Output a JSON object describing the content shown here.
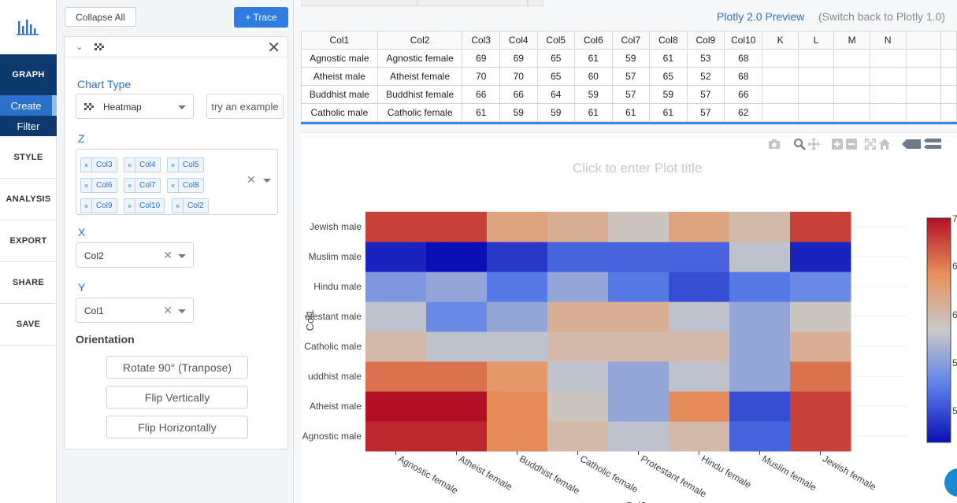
{
  "nav": {
    "graph": "GRAPH",
    "create": "Create",
    "filter": "Filter",
    "style": "STYLE",
    "analysis": "ANALYSIS",
    "export": "EXPORT",
    "share": "SHARE",
    "save": "SAVE"
  },
  "panel": {
    "collapse_all": "Collapse All",
    "add_trace": "+ Trace",
    "chart_type_title": "Chart Type",
    "chart_type_value": "Heatmap",
    "try_example": "try an example",
    "z_label": "Z",
    "z_chips": [
      "Col3",
      "Col4",
      "Col5",
      "Col6",
      "Col7",
      "Col8",
      "Col9",
      "Col10",
      "Col2"
    ],
    "x_label": "X",
    "x_value": "Col2",
    "y_label": "Y",
    "y_value": "Col1",
    "orientation_title": "Orientation",
    "rotate": "Rotate 90° (Tranpose)",
    "flip_v": "Flip Vertically",
    "flip_h": "Flip Horizontally",
    "clear_glyph": "✕",
    "chip_x": "×"
  },
  "header": {
    "preview": "Plotly 2.0 Preview",
    "switch_back": "(Switch back to Plotly 1.0)"
  },
  "grid": {
    "headers": [
      "Col1",
      "Col2",
      "Col3",
      "Col4",
      "Col5",
      "Col6",
      "Col7",
      "Col8",
      "Col9",
      "Col10",
      "K",
      "L",
      "M",
      "N",
      "",
      ""
    ],
    "rows": [
      [
        "Agnostic male",
        "Agnostic female",
        "69",
        "69",
        "65",
        "61",
        "59",
        "61",
        "53",
        "68",
        "",
        "",
        "",
        "",
        "",
        ""
      ],
      [
        "Atheist male",
        "Atheist female",
        "70",
        "70",
        "65",
        "60",
        "57",
        "65",
        "52",
        "68",
        "",
        "",
        "",
        "",
        "",
        ""
      ],
      [
        "Buddhist male",
        "Buddhist female",
        "66",
        "66",
        "64",
        "59",
        "57",
        "59",
        "57",
        "66",
        "",
        "",
        "",
        "",
        "",
        ""
      ],
      [
        "Catholic male",
        "Catholic female",
        "61",
        "59",
        "59",
        "61",
        "61",
        "61",
        "57",
        "62",
        "",
        "",
        "",
        "",
        "",
        ""
      ]
    ]
  },
  "plot": {
    "title_placeholder": "Click to enter Plot title"
  },
  "chart_data": {
    "type": "heatmap",
    "title": "",
    "ylabel": "Col1",
    "xlabel": "Col2",
    "x": [
      "Agnostic female",
      "Atheist female",
      "Buddhist female",
      "Catholic female",
      "Protestant female",
      "Hindu female",
      "Muslim female",
      "Jewish female"
    ],
    "y": [
      "Agnostic male",
      "Atheist male",
      "Buddhist male",
      "Catholic male",
      "Protestant male",
      "Hindu male",
      "Muslim male",
      "Jewish male"
    ],
    "y_tick_labels": [
      "Agnostic male",
      "Atheist male",
      "uddhist male",
      "Catholic male",
      "otestant male",
      "Hindu male",
      "Muslim male",
      "Jewish male"
    ],
    "z": [
      [
        69,
        69,
        65,
        61,
        59,
        61,
        53,
        68
      ],
      [
        70,
        70,
        65,
        60,
        57,
        65,
        52,
        68
      ],
      [
        66,
        66,
        64,
        59,
        57,
        59,
        57,
        66
      ],
      [
        61,
        59,
        59,
        61,
        61,
        61,
        57,
        62
      ],
      [
        59,
        55,
        57,
        62,
        62,
        59,
        57,
        60
      ],
      [
        56,
        57,
        54,
        57,
        54,
        52,
        54,
        55
      ],
      [
        50,
        49,
        51,
        53,
        53,
        53,
        59,
        50
      ],
      [
        68,
        68,
        63,
        62,
        60,
        63,
        61,
        68
      ]
    ],
    "colorscale": [
      "#0a0fb5",
      "#5a7ee8",
      "#c9c9c9",
      "#e8905c",
      "#b31025"
    ],
    "colorbar_ticks": [
      "7",
      "6",
      "6",
      "5",
      "5"
    ]
  }
}
